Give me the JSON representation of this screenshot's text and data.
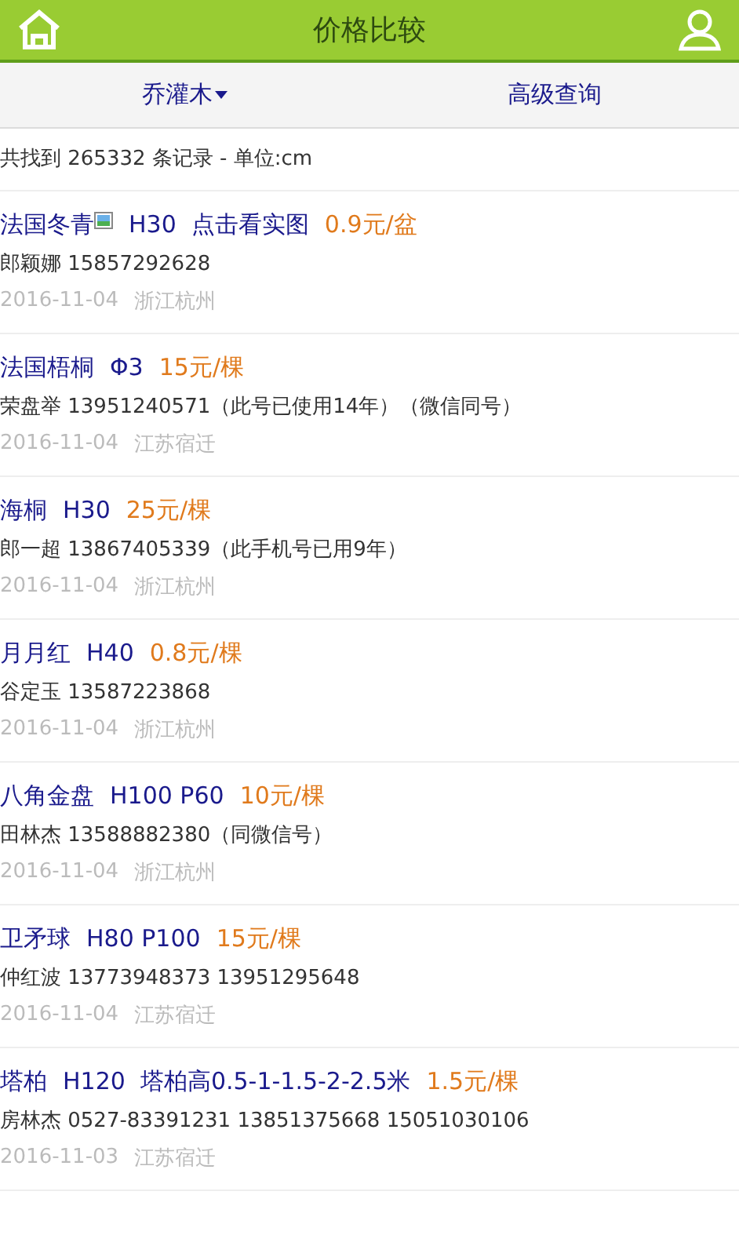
{
  "header": {
    "title": "价格比较"
  },
  "tabs": [
    {
      "label": "乔灌木",
      "dropdown": true
    },
    {
      "label": "高级查询",
      "dropdown": false
    }
  ],
  "summary": "共找到 265332 条记录 - 单位:cm",
  "listings": [
    {
      "name": "法国冬青",
      "has_photo": true,
      "spec": "H30  点击看实图",
      "price": "0.9元/盆",
      "contact": "郎颖娜  15857292628",
      "date": "2016-11-04",
      "place": "浙江杭州"
    },
    {
      "name": "法国梧桐",
      "has_photo": false,
      "spec": "Φ3",
      "price": "15元/棵",
      "contact": "荣盘举  13951240571（此号已使用14年）（微信同号）",
      "date": "2016-11-04",
      "place": "江苏宿迁"
    },
    {
      "name": "海桐",
      "has_photo": false,
      "spec": "H30",
      "price": "25元/棵",
      "contact": "郎一超  13867405339（此手机号已用9年）",
      "date": "2016-11-04",
      "place": "浙江杭州"
    },
    {
      "name": "月月红",
      "has_photo": false,
      "spec": "H40",
      "price": "0.8元/棵",
      "contact": "谷定玉  13587223868",
      "date": "2016-11-04",
      "place": "浙江杭州"
    },
    {
      "name": "八角金盘",
      "has_photo": false,
      "spec": "H100 P60",
      "price": "10元/棵",
      "contact": "田林杰  13588882380（同微信号）",
      "date": "2016-11-04",
      "place": "浙江杭州"
    },
    {
      "name": "卫矛球",
      "has_photo": false,
      "spec": "H80 P100",
      "price": "15元/棵",
      "contact": "仲红波  13773948373 13951295648",
      "date": "2016-11-04",
      "place": "江苏宿迁"
    },
    {
      "name": "塔柏",
      "has_photo": false,
      "spec": "H120  塔柏高0.5-1-1.5-2-2.5米",
      "price": "1.5元/棵",
      "contact": "房林杰  0527-83391231 13851375668 15051030106",
      "date": "2016-11-03",
      "place": "江苏宿迁"
    }
  ]
}
